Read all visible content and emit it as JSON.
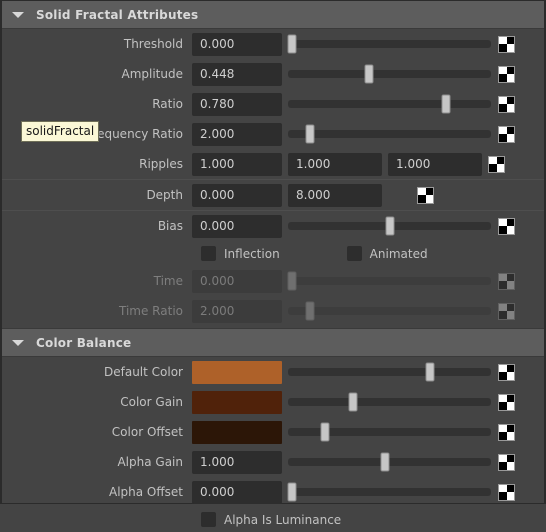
{
  "sections": [
    {
      "id": "solid-fractal-attributes",
      "title": "Solid Fractal Attributes",
      "expanded_icon": "triangle-down-icon"
    },
    {
      "id": "color-balance",
      "title": "Color Balance",
      "expanded_icon": "triangle-down-icon"
    }
  ],
  "tooltip": {
    "text": "solidFractal"
  },
  "fractal": {
    "threshold": {
      "label": "Threshold",
      "value": "0.000",
      "slider_pct": 2,
      "map_icon": "checker-map-icon",
      "disabled": false
    },
    "amplitude": {
      "label": "Amplitude",
      "value": "0.448",
      "slider_pct": 40,
      "map_icon": "checker-map-icon",
      "disabled": false
    },
    "ratio": {
      "label": "Ratio",
      "value": "0.780",
      "slider_pct": 78,
      "map_icon": "checker-map-icon",
      "disabled": false
    },
    "frequency_ratio": {
      "label": "Frequency Ratio",
      "value": "2.000",
      "slider_pct": 11,
      "map_icon": "checker-map-icon",
      "disabled": false
    },
    "ripples": {
      "label": "Ripples",
      "value_x": "1.000",
      "value_y": "1.000",
      "value_z": "1.000",
      "map_icon": "checker-map-icon"
    },
    "depth": {
      "label": "Depth",
      "value_min": "0.000",
      "value_max": "8.000",
      "map_icon": "checker-map-icon"
    },
    "bias": {
      "label": "Bias",
      "value": "0.000",
      "slider_pct": 50,
      "map_icon": "checker-map-icon",
      "disabled": false
    },
    "inflection": {
      "label": "Inflection",
      "checked": false
    },
    "animated": {
      "label": "Animated",
      "checked": false
    },
    "time": {
      "label": "Time",
      "value": "0.000",
      "slider_pct": 2,
      "map_icon": "checker-map-icon",
      "disabled": true
    },
    "time_ratio": {
      "label": "Time Ratio",
      "value": "2.000",
      "slider_pct": 11,
      "map_icon": "checker-map-icon",
      "disabled": true
    }
  },
  "color_balance": {
    "default_color": {
      "label": "Default Color",
      "color": "#ae6129",
      "slider_pct": 70,
      "map_icon": "checker-map-icon"
    },
    "color_gain": {
      "label": "Color Gain",
      "color": "#50220a",
      "slider_pct": 32,
      "map_icon": "checker-map-icon"
    },
    "color_offset": {
      "label": "Color Offset",
      "color": "#2c1607",
      "slider_pct": 18,
      "map_icon": "checker-map-icon"
    },
    "alpha_gain": {
      "label": "Alpha Gain",
      "value": "1.000",
      "slider_pct": 48,
      "map_icon": "checker-map-icon"
    },
    "alpha_offset": {
      "label": "Alpha Offset",
      "value": "0.000",
      "slider_pct": 2,
      "map_icon": "checker-map-icon"
    },
    "alpha_is_luminance": {
      "label": "Alpha Is Luminance",
      "checked": false
    }
  }
}
